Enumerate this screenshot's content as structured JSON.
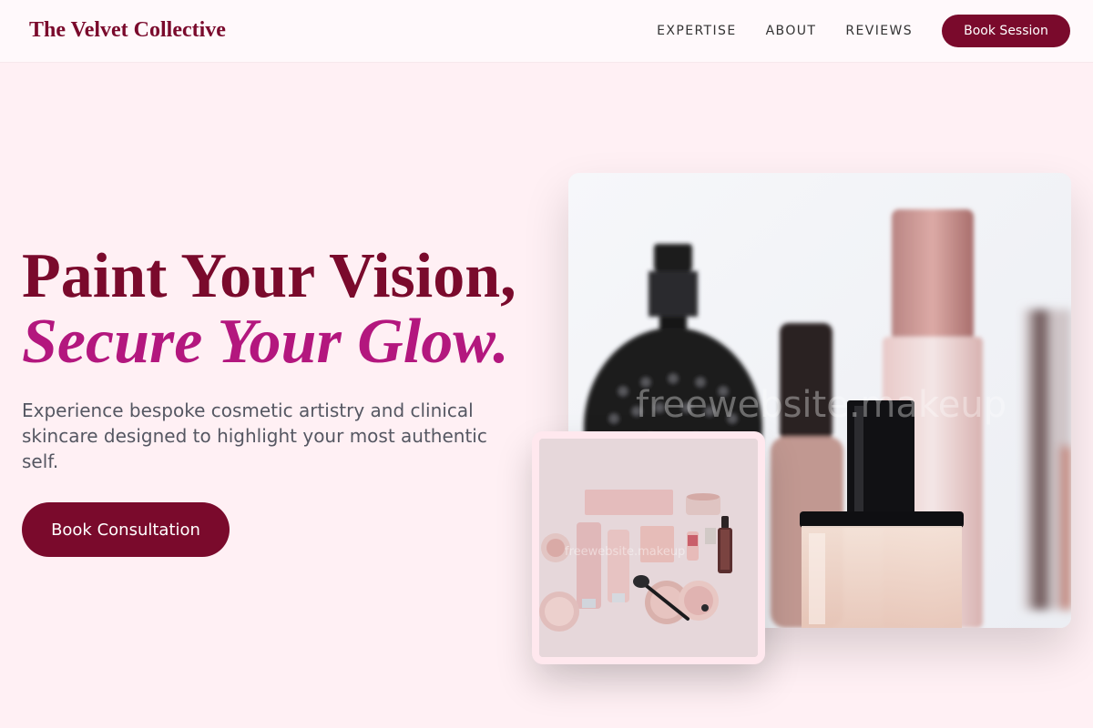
{
  "brand": {
    "name": "The Velvet Collective"
  },
  "nav": {
    "links": [
      "EXPERTISE",
      "ABOUT",
      "REVIEWS"
    ],
    "cta_label": "Book Session"
  },
  "hero": {
    "title_line1": "Paint Your Vision,",
    "title_line2": "Secure Your Glow.",
    "subtitle": "Experience bespoke cosmetic artistry and clinical skincare designed to highlight your most authentic self.",
    "cta_label": "Book Consultation"
  },
  "images": {
    "main_watermark": "freewebsite.makeup",
    "inset_watermark": "freewebsite.makeup"
  },
  "colors": {
    "brand": "#7a0a2c",
    "accent": "#b3177e",
    "background": "#fff0f4"
  }
}
